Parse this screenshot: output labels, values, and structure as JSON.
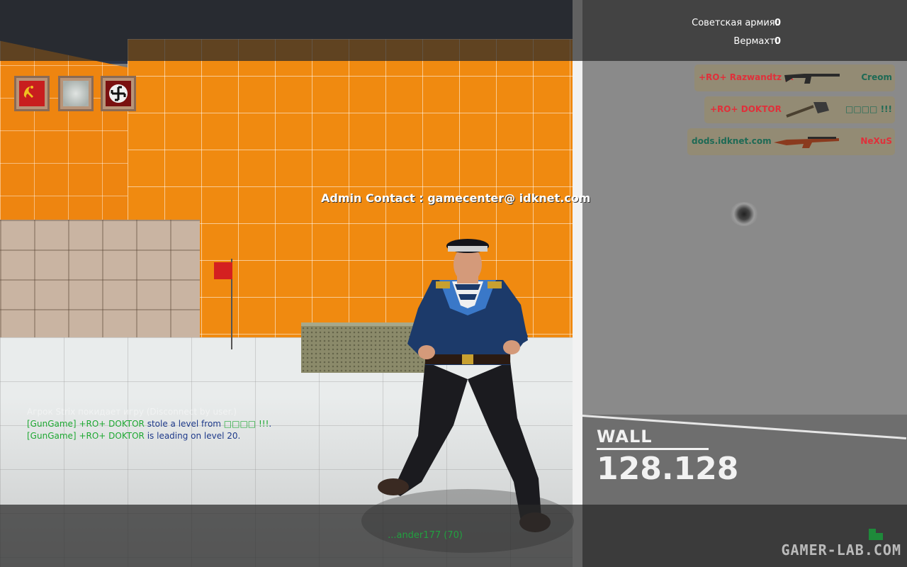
{
  "scoreboard": {
    "teams": [
      {
        "name": "Советская армия:",
        "score": "0"
      },
      {
        "name": "Вермахт:",
        "score": "0"
      }
    ]
  },
  "team_icons": [
    {
      "icon": "soviet-flag-icon",
      "color": "#c81e1e"
    },
    {
      "icon": "spectator-icon",
      "color": "#a8b0ac"
    },
    {
      "icon": "german-flag-icon",
      "color": "#7a1010"
    }
  ],
  "admin_contact": "Admin Contact : gamecenter@ idknet.com",
  "killfeed": [
    {
      "killer": "+RO+ Razwandtz ;x",
      "weapon": "rifle-ak-icon",
      "victim": "Creom"
    },
    {
      "killer": "+RO+ DOKTOR",
      "weapon": "shovel-icon",
      "victim": "□□□□ !!!"
    },
    {
      "killer": "dods.idknet.com",
      "weapon": "rifle-svt-icon",
      "victim": "NeXuS"
    }
  ],
  "chat": {
    "faded": "Агрок Strix покидает игру (Disconnect by user.)",
    "lines": [
      {
        "tag": "[GunGame]",
        "player": "+RO+ DOKTOR",
        "text": " stole a level from ",
        "target": "□□□□ !!!",
        "end": "."
      },
      {
        "tag": "[GunGame]",
        "player": "+RO+ DOKTOR",
        "text": " is leading on level 20.",
        "target": "",
        "end": ""
      }
    ]
  },
  "surface": {
    "label": "WALL",
    "value": "128.128"
  },
  "spectating": "...ander177 (70)",
  "watermark": "GAMER-LAB.COM",
  "colors": {
    "orange_wall": "#f08a10",
    "hud_band": "#282828",
    "killer_red": "#e0303a",
    "chat_green": "#1ea832"
  }
}
